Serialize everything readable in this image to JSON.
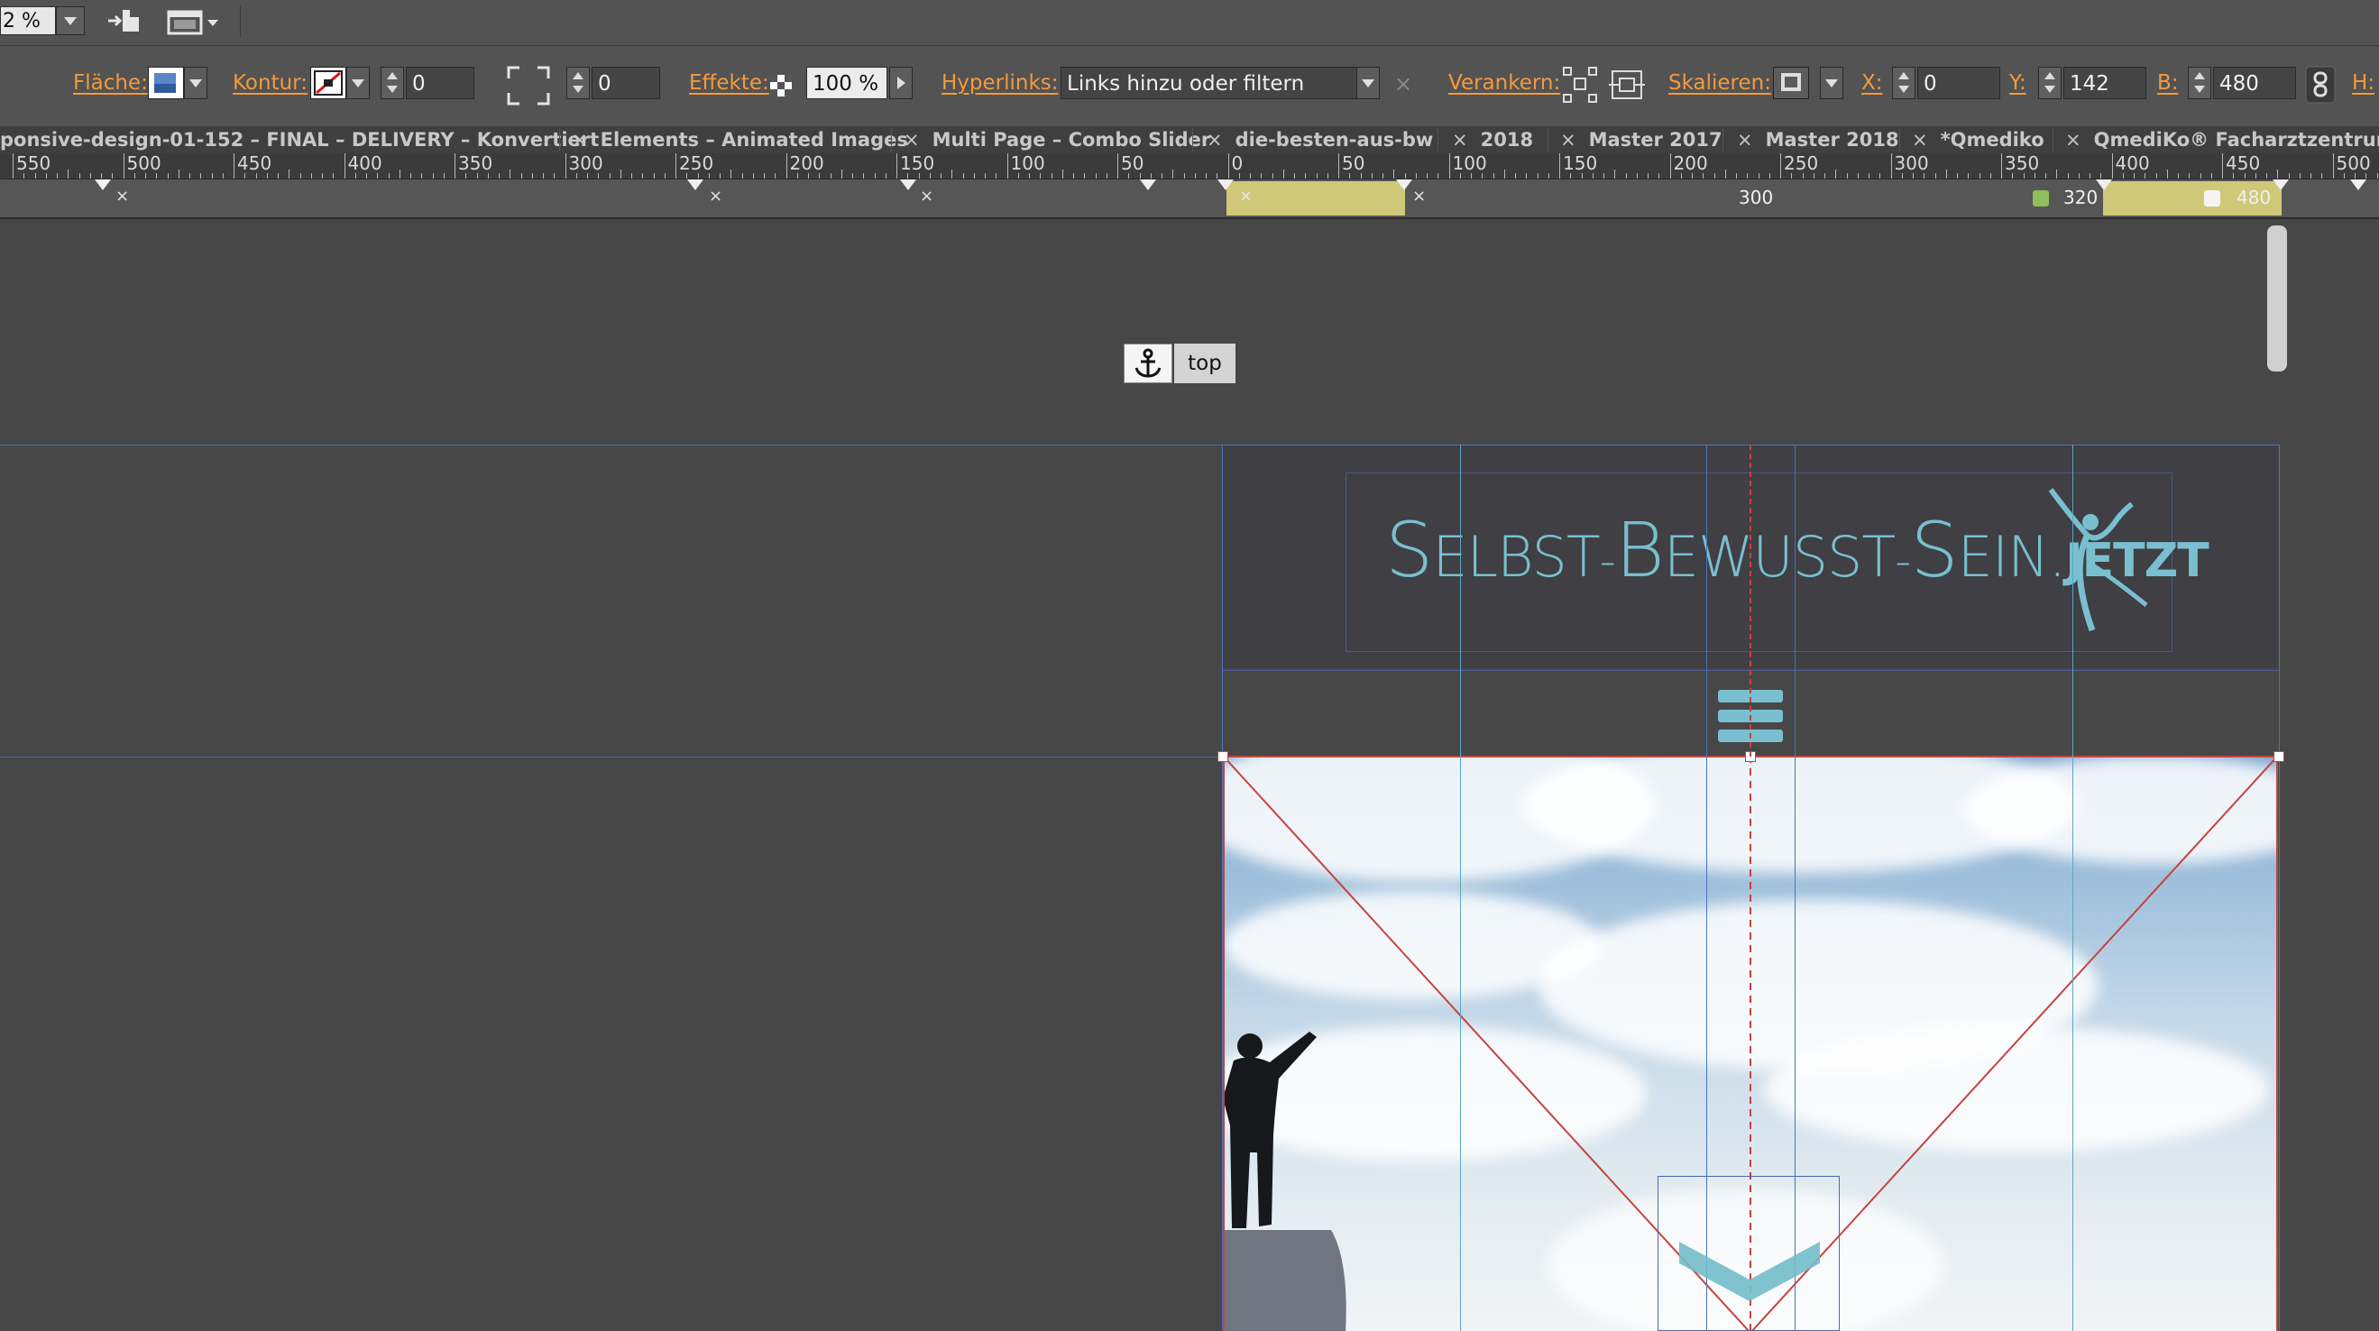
{
  "toolbar": {
    "zoom_value": "2 %"
  },
  "control_bar": {
    "flaeche_label": "Fläche:",
    "kontur_label": "Kontur:",
    "kontur_width": "0",
    "corner_value": "0",
    "effekte_label": "Effekte:",
    "opacity_value": "100 %",
    "hyperlinks_label": "Hyperlinks:",
    "hyperlinks_value": "Links hinzu oder filtern",
    "verankern_label": "Verankern:",
    "skalieren_label": "Skalieren:",
    "x_label": "X:",
    "x_value": "0",
    "y_label": "Y:",
    "y_value": "142",
    "b_label": "B:",
    "b_value": "480",
    "h_label": "H:"
  },
  "tabs": [
    {
      "label": "ponsive-design-01-152 – FINAL – DELIVERY – Konvertiert"
    },
    {
      "label": "Elements – Animated Images"
    },
    {
      "label": "Multi Page – Combo Slider"
    },
    {
      "label": "die-besten-aus-bw"
    },
    {
      "label": "2018"
    },
    {
      "label": "Master 2017"
    },
    {
      "label": "Master 2018"
    },
    {
      "label": "*Qmediko"
    },
    {
      "label": "QmediKo® Facharztzentrum Se"
    }
  ],
  "tab_close_glyph": "×",
  "ruler": {
    "labels": [
      "550",
      "500",
      "450",
      "400",
      "350",
      "300",
      "250",
      "200",
      "150",
      "100",
      "50",
      "0",
      "50",
      "100",
      "150",
      "200",
      "250",
      "300",
      "350",
      "400",
      "450",
      "500"
    ]
  },
  "breakpoints": {
    "mid_label": "300",
    "label_320": "320",
    "label_480": "480",
    "close_glyph": "×"
  },
  "canvas": {
    "anchor_label": "top",
    "logo": {
      "s1": "S",
      "w1": "ELBST",
      "s2": "B",
      "w2": "EWUSST",
      "s3": "S",
      "w3": "EIN",
      "dot": ".",
      "w4": "JETZT"
    }
  },
  "colors": {
    "accent_orange": "#f29a3e",
    "logo_teal": "#79bfd0",
    "breakpoint_yellow": "#cfc878",
    "breakpoint_green": "#8fbf5a"
  }
}
